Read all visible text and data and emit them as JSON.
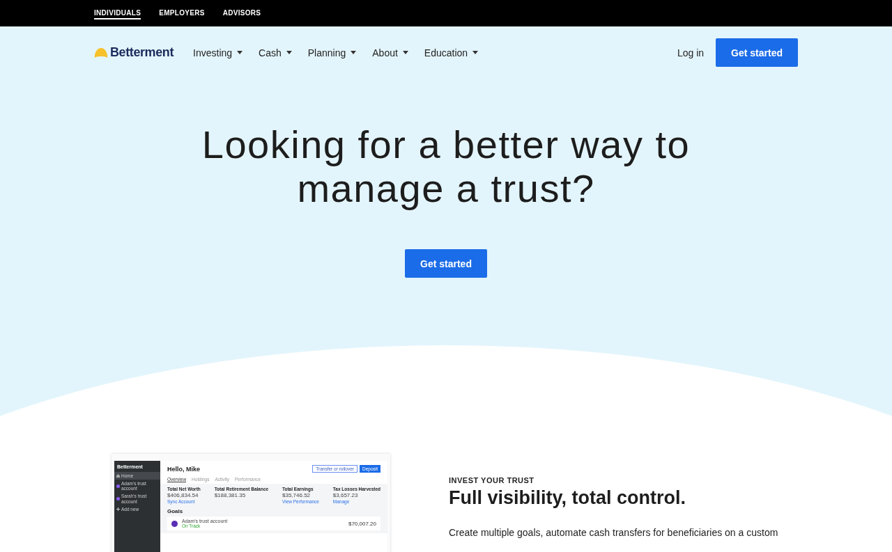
{
  "top_bar": {
    "links": [
      {
        "label": "INDIVIDUALS",
        "selected": true
      },
      {
        "label": "EMPLOYERS",
        "selected": false
      },
      {
        "label": "ADVISORS",
        "selected": false
      }
    ]
  },
  "nav": {
    "brand": "Betterment",
    "menu": [
      "Investing",
      "Cash",
      "Planning",
      "About",
      "Education"
    ],
    "login": "Log in",
    "cta": "Get started"
  },
  "hero": {
    "title": "Looking for a better way to manage a trust?",
    "cta": "Get started"
  },
  "mockup": {
    "brand": "Betterment",
    "sidebar": [
      {
        "kind": "home",
        "label": "Home",
        "selected": true
      },
      {
        "kind": "account",
        "label": "Adam's trust account",
        "selected": false
      },
      {
        "kind": "account",
        "label": "Sarah's trust account",
        "selected": false
      },
      {
        "kind": "add",
        "label": "Add new",
        "selected": false
      }
    ],
    "greeting": "Hello, Mike",
    "transfer": "Transfer or rollover",
    "deposit": "Deposit",
    "tabs": [
      {
        "label": "Overview",
        "selected": true
      },
      {
        "label": "Holdings",
        "selected": false
      },
      {
        "label": "Activity",
        "selected": false
      },
      {
        "label": "Performance",
        "selected": false
      }
    ],
    "stats": [
      {
        "label": "Total Net Worth",
        "value": "$406,834.54",
        "link": "Sync Account"
      },
      {
        "label": "Total Retirement Balance",
        "value": "$188,381.35"
      },
      {
        "label": "Total Earnings",
        "value": "$35,746.52",
        "link": "View Performance"
      },
      {
        "label": "Tax Losses Harvested",
        "value": "$3,657.23",
        "link": "Manage"
      }
    ],
    "goals_title": "Goals",
    "goal": {
      "name": "Adam's trust account",
      "status": "On Track",
      "amount": "$70,007.20"
    }
  },
  "feature": {
    "eyebrow": "INVEST YOUR TRUST",
    "title": "Full visibility, total control.",
    "body": "Create multiple goals, automate cash transfers for beneficiaries on a custom"
  }
}
